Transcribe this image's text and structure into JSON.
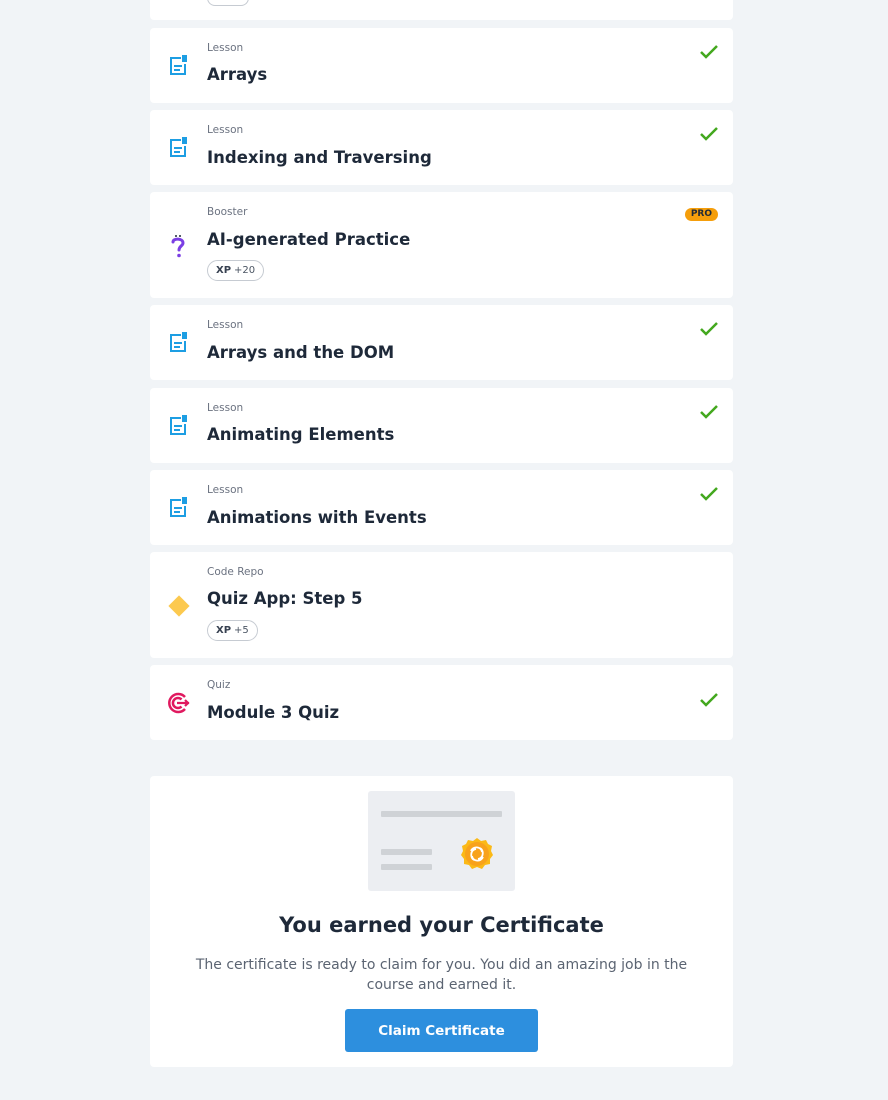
{
  "items": [
    {
      "type": "Lesson",
      "title": "Arrays",
      "icon": "lesson-icon",
      "completed": true
    },
    {
      "type": "Lesson",
      "title": "Indexing and Traversing",
      "icon": "lesson-icon",
      "completed": true
    },
    {
      "type": "Booster",
      "title": "AI-generated Practice",
      "icon": "question-icon",
      "badge": "PRO",
      "xp_label": "XP",
      "xp_value": "+20"
    },
    {
      "type": "Lesson",
      "title": "Arrays and the DOM",
      "icon": "lesson-icon",
      "completed": true
    },
    {
      "type": "Lesson",
      "title": "Animating Elements",
      "icon": "lesson-icon",
      "completed": true
    },
    {
      "type": "Lesson",
      "title": "Animations with Events",
      "icon": "lesson-icon",
      "completed": true
    },
    {
      "type": "Code Repo",
      "title": "Quiz App: Step 5",
      "icon": "diamond-icon",
      "xp_label": "XP",
      "xp_value": "+5"
    },
    {
      "type": "Quiz",
      "title": "Module 3 Quiz",
      "icon": "target-icon",
      "completed": true
    }
  ],
  "certificate": {
    "title": "You earned your Certificate",
    "description": "The certificate is ready to claim for you. You did an amazing job in the course and earned it.",
    "button_label": "Claim Certificate"
  },
  "colors": {
    "lesson_icon": "#1d9ee3",
    "check": "#43a81e",
    "pro_badge": "#f59e0b",
    "button": "#2d8fde",
    "quiz_icon": "#e0195f",
    "repo_icon": "#fcc94f",
    "booster_icon": "#7b3fe4"
  }
}
